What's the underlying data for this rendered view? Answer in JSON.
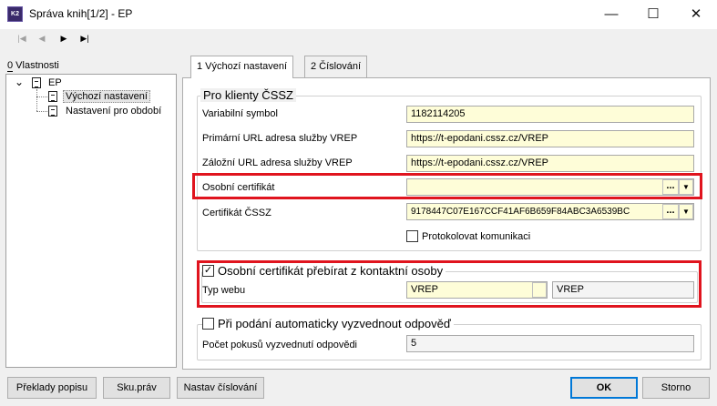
{
  "window": {
    "app_icon_text": "K2",
    "title": "Správa knih[1/2] - EP",
    "minimize_glyph": "—",
    "maximize_glyph": "☐",
    "close_glyph": "✕"
  },
  "toolbar": {
    "first_glyph": "|◀",
    "prev_glyph": "◀",
    "next_glyph": "▶",
    "last_glyph": "▶|"
  },
  "tree": {
    "label": "0 Vlastnosti",
    "expand_glyph": "⌄",
    "root": "EP",
    "children": [
      "Výchozí nastavení",
      "Nastavení pro období"
    ]
  },
  "tabs": [
    {
      "label": "1 Výchozí nastavení",
      "active": true
    },
    {
      "label": "2 Číslování",
      "active": false
    }
  ],
  "group_cssz": {
    "title": "Pro klienty ČSSZ",
    "variabilni_symbol_label": "Variabilní symbol",
    "variabilni_symbol_value": "1182114205",
    "primarni_url_label": "Primární URL adresa služby VREP",
    "primarni_url_value": "https://t-epodani.cssz.cz/VREP",
    "zalozni_url_label": "Záložní URL adresa služby VREP",
    "zalozni_url_value": "https://t-epodani.cssz.cz/VREP",
    "osobni_cert_label": "Osobní certifikát",
    "osobni_cert_value": "",
    "cert_cssz_label": "Certifikát ČSSZ",
    "cert_cssz_value": "9178447C07E167CCF41AF6B659F84ABC3A6539BC",
    "dots_glyph": "...",
    "dropdown_glyph": "▼",
    "protokolovat_label": "Protokolovat komunikaci",
    "protokolovat_checked": false
  },
  "group_kontakt": {
    "checkbox_label": "Osobní certifikát přebírat z kontaktní osoby",
    "checkbox_checked": true,
    "check_glyph": "✓",
    "typ_webu_label": "Typ webu",
    "typ_webu_value": "VREP",
    "typ_webu_desc": "VREP"
  },
  "group_odpoved": {
    "checkbox_label": "Při podání automaticky vyzvednout odpověď",
    "checkbox_checked": false,
    "pocet_label": "Počet pokusů vyzvednutí odpovědi",
    "pocet_value": "5"
  },
  "buttons": {
    "preklady": "Překlady popisu",
    "sku_prav": "Sku.práv",
    "nastav_cislovani": "Nastav číslování",
    "ok": "OK",
    "storno": "Storno"
  },
  "colors": {
    "highlight": "#e0141e",
    "field_bg": "#fefdd8",
    "default_button_border": "#0078d7"
  }
}
